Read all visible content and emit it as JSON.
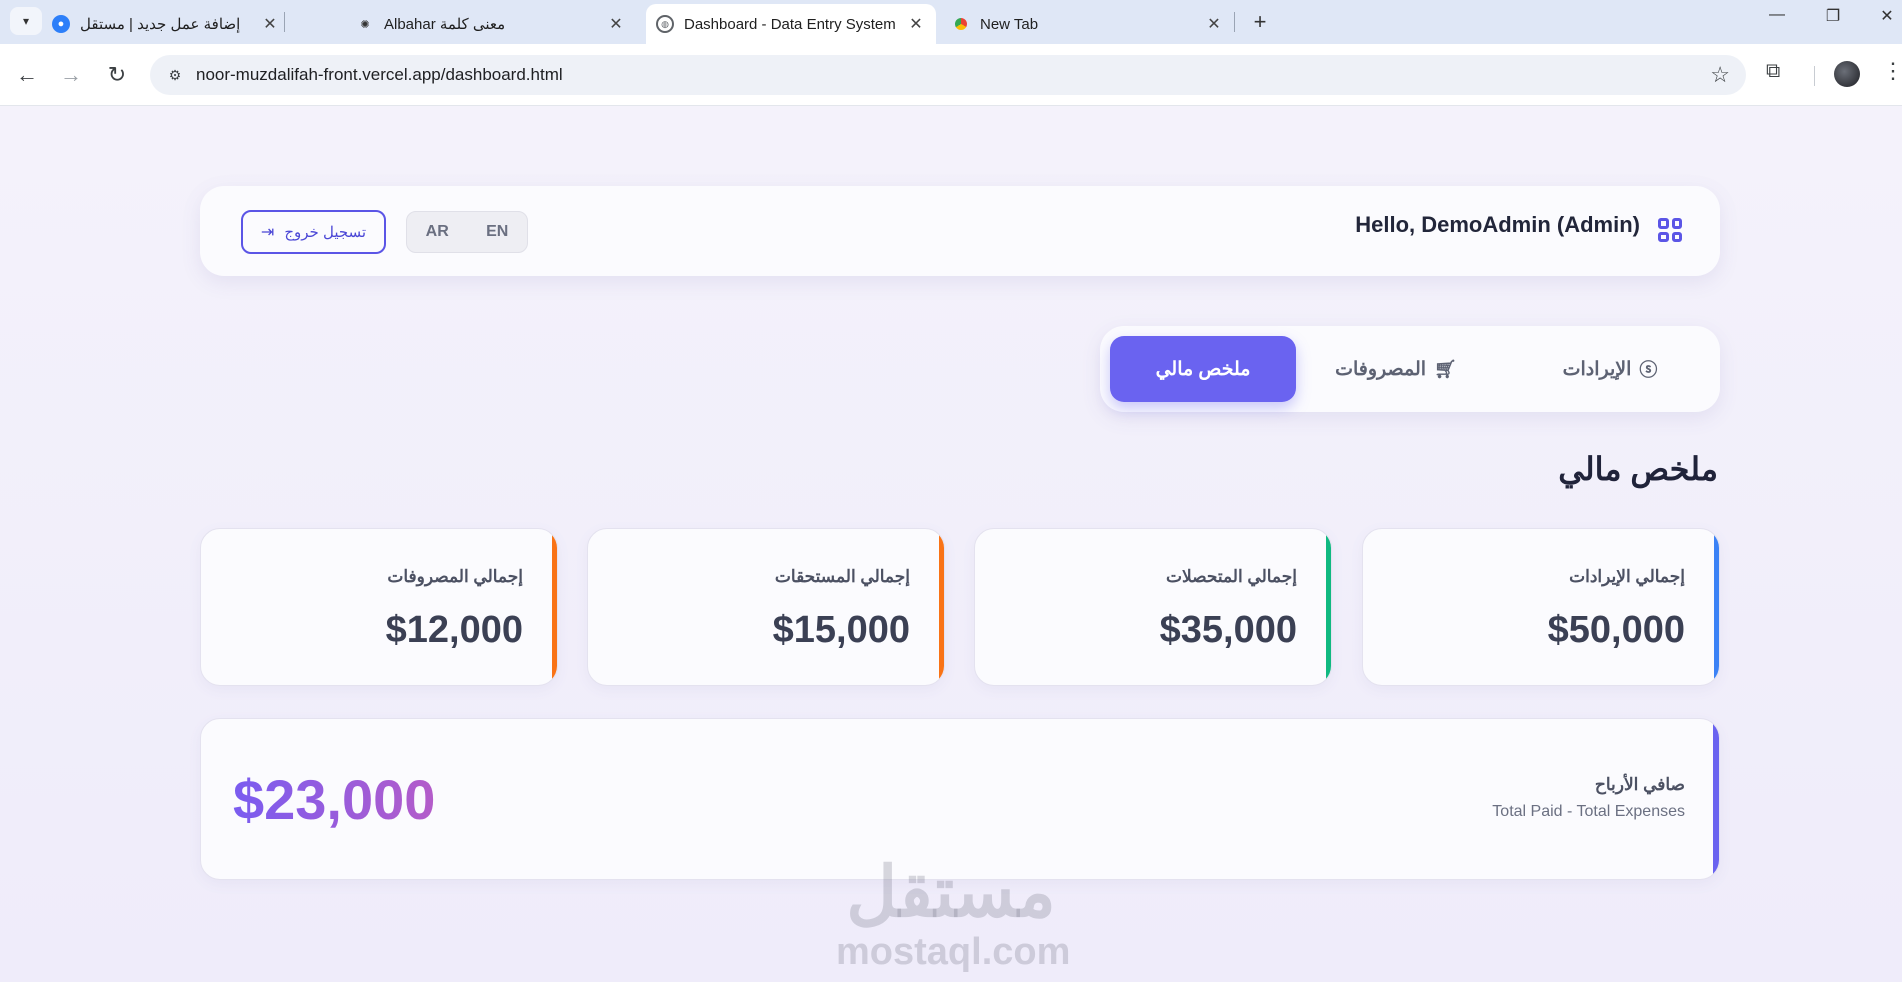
{
  "browser": {
    "tabs": [
      {
        "title": "إضافة عمل جديد | مستقل",
        "close": "✕"
      },
      {
        "title": "معنى كلمة Albahar",
        "close": "✕"
      },
      {
        "title": "Dashboard - Data Entry System",
        "close": "✕"
      },
      {
        "title": "New Tab",
        "close": "✕"
      }
    ],
    "new_tab": "+",
    "url": "noor-muzdalifah-front.vercel.app/dashboard.html"
  },
  "header": {
    "greeting": "Hello, DemoAdmin (Admin)",
    "logout_label": "تسجيل خروج",
    "lang_en": "EN",
    "lang_ar": "AR"
  },
  "tabs": [
    {
      "label": "الإيرادات",
      "icon": "dollar-circle-icon"
    },
    {
      "label": "المصروفات",
      "icon": "cart-icon"
    },
    {
      "label": "ملخص مالي",
      "active": true
    }
  ],
  "summary": {
    "title": "ملخص مالي",
    "cards": [
      {
        "label": "إجمالي الإيرادات",
        "value": "$50,000",
        "color": "#3b82f6"
      },
      {
        "label": "إجمالي المتحصلات",
        "value": "$35,000",
        "color": "#10b981"
      },
      {
        "label": "إجمالي المستحقات",
        "value": "$15,000",
        "color": "#f97316"
      },
      {
        "label": "إجمالي المصروفات",
        "value": "$12,000",
        "color": "#f97316"
      }
    ],
    "net": {
      "label": "صافي الأرباح",
      "subtitle": "Total Paid - Total Expenses",
      "value": "$23,000",
      "color": "#6a63f0"
    }
  },
  "watermark": {
    "ar": "مستقل",
    "en": "mostaql.com"
  },
  "colors": {
    "accent": "#6a63f0",
    "page_bg": "#f3f0fb"
  }
}
